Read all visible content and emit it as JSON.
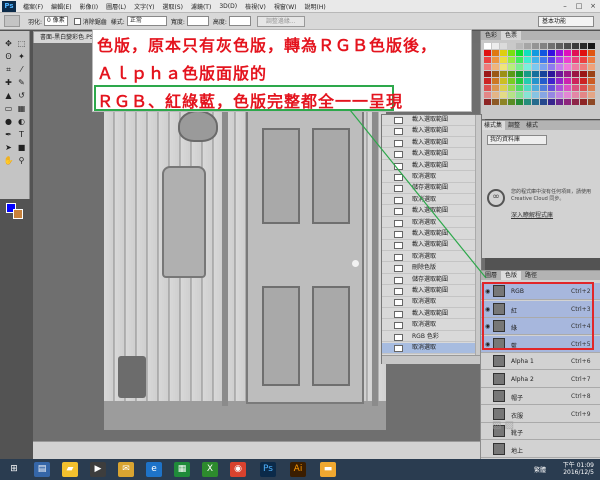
{
  "menubar": {
    "logo": "Ps",
    "items": [
      "檔案(F)",
      "編輯(E)",
      "影像(I)",
      "圖層(L)",
      "文字(Y)",
      "選取(S)",
      "濾鏡(T)",
      "3D(D)",
      "檢視(V)",
      "視窗(W)",
      "說明(H)"
    ],
    "window_controls": [
      "–",
      "□",
      "×"
    ]
  },
  "optbar": {
    "feather_label": "羽化:",
    "feather_value": "0 像素",
    "antialias_label": "消除鋸齒",
    "style_label": "樣式:",
    "style_value": "正常",
    "width_label": "寬度:",
    "height_label": "高度:",
    "refine_button": "調整邊緣...",
    "workspace": "基本功能"
  },
  "document": {
    "tab_title": "書面-黑白變彩色.PSD @ 33.3%(RGB/8)"
  },
  "panels": {
    "swatches_tabs": [
      "色彩",
      "色票"
    ],
    "adjust_tabs": [
      "樣式集",
      "調整",
      "樣式"
    ],
    "adjust_dropdown": "我的資料庫",
    "cc_message": "您的程式庫中沒有任何項目，請使用 Creative Cloud 同步。",
    "cc_link": "深入瞭解程式庫",
    "channels_tabs": [
      "圖層",
      "色版",
      "路徑"
    ]
  },
  "history": [
    "載入選取範圍",
    "載入選取範圍",
    "載入選取範圍",
    "載入選取範圍",
    "載入選取範圍",
    "取消選取",
    "儲存選取範圍",
    "取消選取",
    "載入選取範圍",
    "取消選取",
    "載入選取範圍",
    "載入選取範圍",
    "取消選取",
    "刪除色版",
    "儲存選取範圍",
    "載入選取範圍",
    "取消選取",
    "載入選取範圍",
    "取消選取",
    "RGB 色彩",
    "取消選取"
  ],
  "channels": [
    {
      "name": "RGB",
      "shortcut": "Ctrl+2",
      "selected": true
    },
    {
      "name": "紅",
      "shortcut": "Ctrl+3",
      "selected": true
    },
    {
      "name": "綠",
      "shortcut": "Ctrl+4",
      "selected": true
    },
    {
      "name": "藍",
      "shortcut": "Ctrl+5",
      "selected": true
    },
    {
      "name": "Alpha 1",
      "shortcut": "Ctrl+6",
      "selected": false
    },
    {
      "name": "Alpha 2",
      "shortcut": "Ctrl+7",
      "selected": false
    },
    {
      "name": "帽子",
      "shortcut": "Ctrl+8",
      "selected": false
    },
    {
      "name": "衣服",
      "shortcut": "Ctrl+9",
      "selected": false
    },
    {
      "name": "靴子",
      "shortcut": "",
      "selected": false
    },
    {
      "name": "地上",
      "shortcut": "",
      "selected": false
    }
  ],
  "callout": {
    "line1": "色版，原本只有灰色版，轉為ＲＧＢ色版後，",
    "line2": "Ａｌｐｈａ色版面版的",
    "line3": "ＲＧＢ、紅綠藍，色版完整都全一一呈現"
  },
  "taskbar": {
    "lang": "繁體",
    "time": "下午 01:09",
    "date": "2016/12/5"
  },
  "colors": {
    "foreground": "#0000ff",
    "background": "#c8823c",
    "annotation_red": "#e4141e",
    "highlight_green": "#2da84b",
    "selection_blue": "#a7b7dd"
  }
}
